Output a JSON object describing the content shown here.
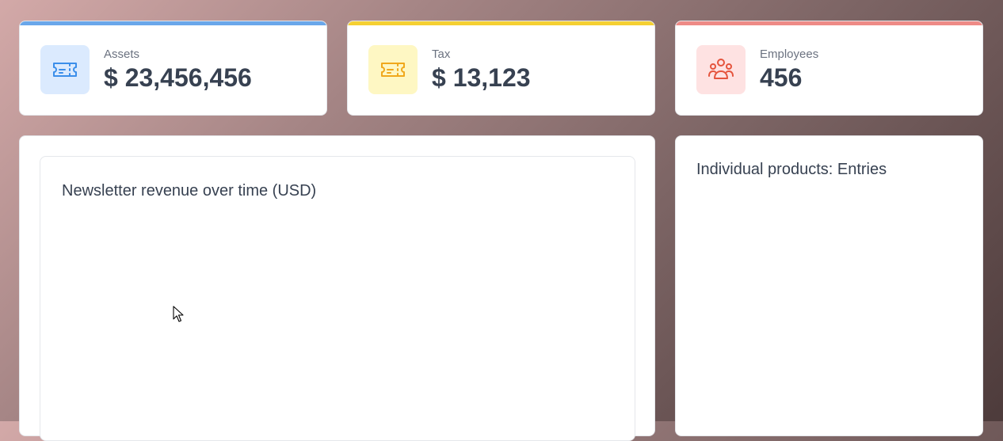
{
  "stats": [
    {
      "label": "Assets",
      "value": "$ 23,456,456",
      "icon": "ticket-icon",
      "accent_color": "#6aa7ea",
      "icon_bg": "#dbeafe",
      "icon_color": "#3b8eea"
    },
    {
      "label": "Tax",
      "value": "$ 13,123",
      "icon": "ticket-icon",
      "accent_color": "#f5d032",
      "icon_bg": "#fef7c3",
      "icon_color": "#f0a81c"
    },
    {
      "label": "Employees",
      "value": "456",
      "icon": "users-group-icon",
      "accent_color": "#ee8a86",
      "icon_bg": "#fee2e2",
      "icon_color": "#e5543d"
    }
  ],
  "revenue_panel": {
    "title": "Newsletter revenue over time (USD)"
  },
  "products_panel": {
    "title": "Individual products: Entries"
  }
}
